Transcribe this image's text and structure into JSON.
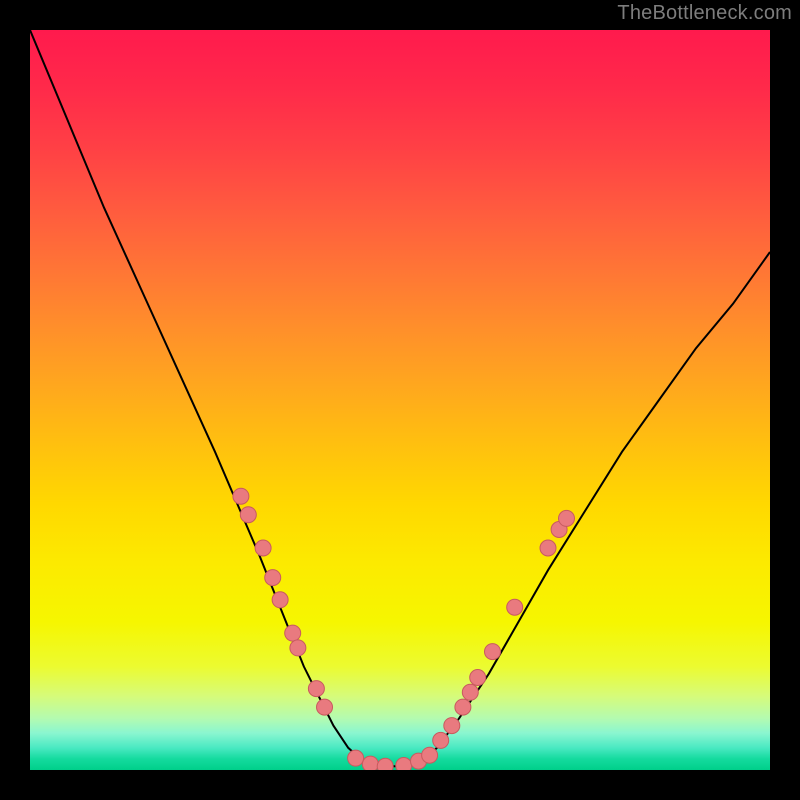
{
  "watermark": "TheBottleneck.com",
  "chart_data": {
    "type": "line",
    "title": "",
    "xlabel": "",
    "ylabel": "",
    "xlim": [
      0,
      100
    ],
    "ylim": [
      0,
      100
    ],
    "grid": false,
    "series": [
      {
        "name": "bottleneck-curve",
        "x": [
          0,
          5,
          10,
          15,
          20,
          25,
          28,
          31,
          33,
          35,
          37,
          39,
          41,
          43,
          45,
          47,
          50,
          53,
          55,
          58,
          62,
          66,
          70,
          75,
          80,
          85,
          90,
          95,
          100
        ],
        "y": [
          100,
          88,
          76,
          65,
          54,
          43,
          36,
          29,
          24,
          19,
          14,
          10,
          6,
          3,
          1.2,
          0.5,
          0.5,
          1.2,
          3,
          7,
          13,
          20,
          27,
          35,
          43,
          50,
          57,
          63,
          70
        ]
      }
    ],
    "markers_left": [
      {
        "x": 28.5,
        "y": 37
      },
      {
        "x": 29.5,
        "y": 34.5
      },
      {
        "x": 31.5,
        "y": 30
      },
      {
        "x": 32.8,
        "y": 26
      },
      {
        "x": 33.8,
        "y": 23
      },
      {
        "x": 35.5,
        "y": 18.5
      },
      {
        "x": 36.2,
        "y": 16.5
      },
      {
        "x": 38.7,
        "y": 11
      },
      {
        "x": 39.8,
        "y": 8.5
      }
    ],
    "markers_bottom": [
      {
        "x": 44,
        "y": 1.6
      },
      {
        "x": 46,
        "y": 0.8
      },
      {
        "x": 48,
        "y": 0.5
      },
      {
        "x": 50.5,
        "y": 0.6
      },
      {
        "x": 52.5,
        "y": 1.2
      },
      {
        "x": 54,
        "y": 2.0
      }
    ],
    "markers_right": [
      {
        "x": 55.5,
        "y": 4
      },
      {
        "x": 57,
        "y": 6
      },
      {
        "x": 58.5,
        "y": 8.5
      },
      {
        "x": 59.5,
        "y": 10.5
      },
      {
        "x": 60.5,
        "y": 12.5
      },
      {
        "x": 62.5,
        "y": 16
      },
      {
        "x": 65.5,
        "y": 22
      },
      {
        "x": 70,
        "y": 30
      },
      {
        "x": 71.5,
        "y": 32.5
      },
      {
        "x": 72.5,
        "y": 34
      }
    ],
    "colors": {
      "curve": "#000000",
      "marker_fill": "#e97a7f",
      "marker_stroke": "#c85a5f"
    }
  }
}
